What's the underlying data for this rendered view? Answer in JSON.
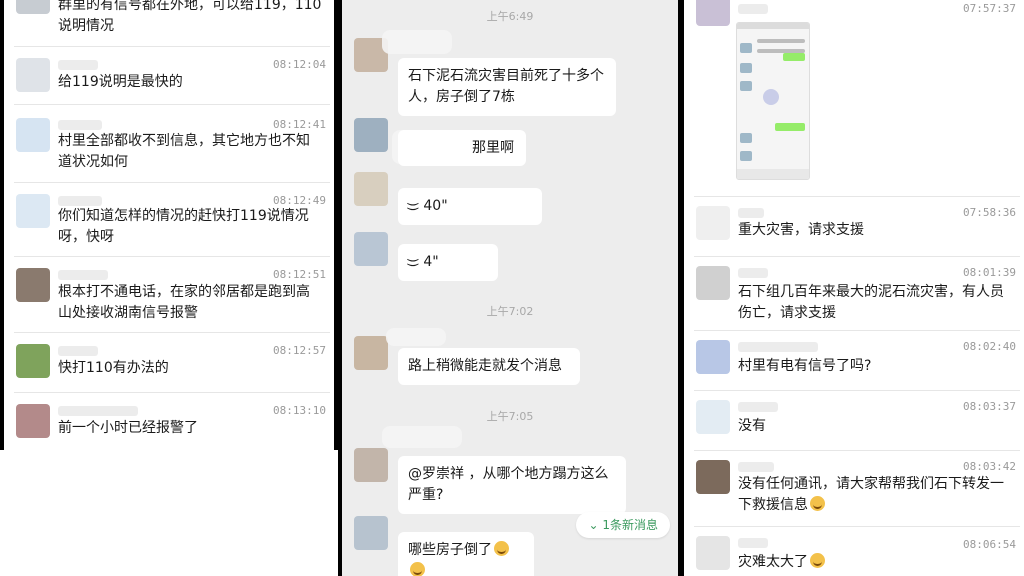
{
  "panel_left": {
    "messages": [
      {
        "time": "",
        "text": "群里的有信号都在外地，可以给119，110说明情况"
      },
      {
        "time": "08:12:04",
        "text": "给119说明是最快的"
      },
      {
        "time": "08:12:41",
        "text": "村里全部都收不到信息，其它地方也不知道状况如何"
      },
      {
        "time": "08:12:49",
        "text": "你们知道怎样的情况的赶快打119说情况呀，快呀"
      },
      {
        "time": "08:12:51",
        "text": "根本打不通电话，在家的邻居都是跑到高山处接收湖南信号报警"
      },
      {
        "time": "08:12:57",
        "text": "快打110有办法的"
      },
      {
        "time": "08:13:10",
        "text": "前一个小时已经报警了"
      }
    ]
  },
  "panel_middle": {
    "timestamps": [
      "上午6:49",
      "上午7:02",
      "上午7:05"
    ],
    "bubbles": [
      {
        "text": "石下泥石流灾害目前死了十多个人，房子倒了7栋"
      },
      {
        "text": "那里啊"
      },
      {
        "text": "40\""
      },
      {
        "text": "4\""
      },
      {
        "text": "路上稍微能走就发个消息"
      },
      {
        "text": "@罗崇祥 ，从哪个地方蹋方这么严重?"
      },
      {
        "text": "哪些房子倒了"
      }
    ],
    "new_messages": "1条新消息",
    "new_messages_icon": "double-chevron-down"
  },
  "panel_right": {
    "messages": [
      {
        "time": "07:57:37",
        "text": ""
      },
      {
        "time": "07:58:36",
        "text": "重大灾害，请求支援"
      },
      {
        "time": "08:01:39",
        "text": "石下组几百年来最大的泥石流灾害，有人员伤亡，请求支援"
      },
      {
        "time": "08:02:40",
        "text": "村里有电有信号了吗?"
      },
      {
        "time": "08:03:37",
        "text": "没有"
      },
      {
        "time": "08:03:42",
        "text": "没有任何通讯，请大家帮帮我们石下转发一下救援信息"
      },
      {
        "time": "08:06:54",
        "text": "灾难太大了"
      }
    ]
  },
  "colors": {
    "accent_green": "#3c9a5f",
    "bubble_white": "#ffffff",
    "chat_bg": "#ededed",
    "emoji_yellow": "#f3c14a"
  }
}
